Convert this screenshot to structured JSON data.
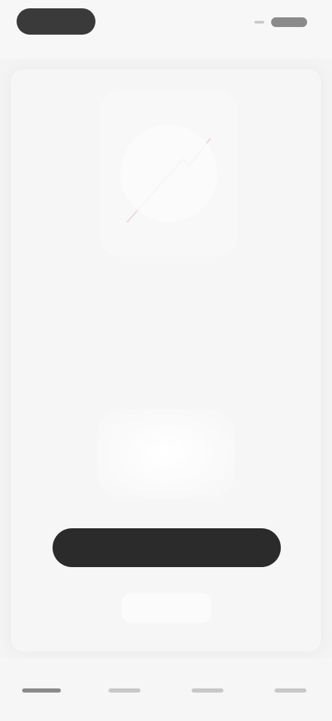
{
  "top_bar": {
    "pill_label": "",
    "right_label": ""
  },
  "card": {
    "headline": "",
    "subline": "",
    "primary_button_label": "",
    "secondary_link_label": ""
  },
  "bottom_nav": {
    "items": [
      {
        "label": "",
        "active": true
      },
      {
        "label": "",
        "active": false
      },
      {
        "label": "",
        "active": false
      },
      {
        "label": "",
        "active": false
      }
    ]
  },
  "colors": {
    "background": "#f4f4f4",
    "primary_button": "#2b2b2b",
    "pill": "#3a3a3a",
    "accent_line": "#f2c9c9"
  },
  "icons": {
    "illustration": "decorative-illustration"
  }
}
